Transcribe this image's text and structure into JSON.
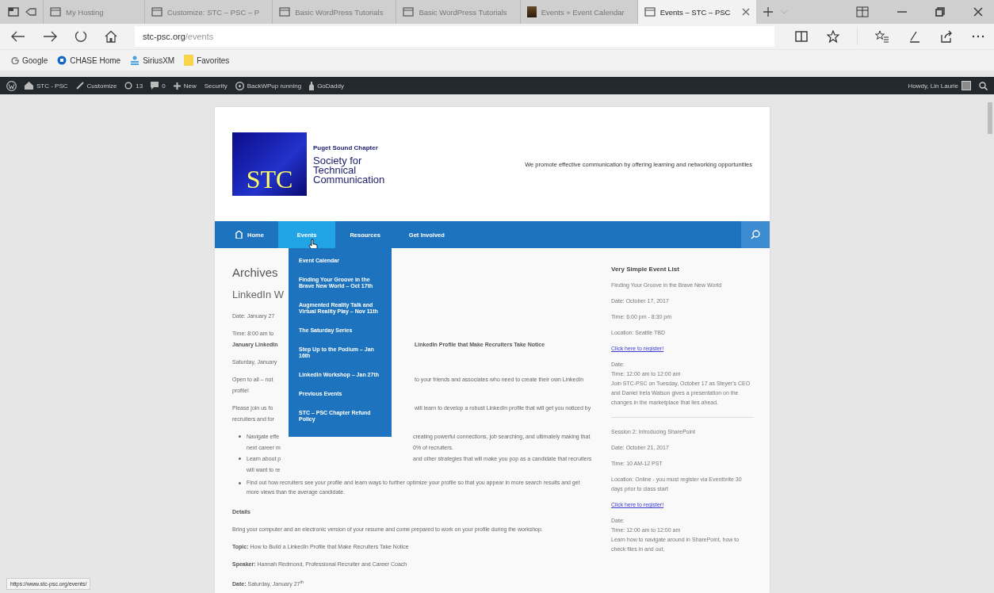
{
  "browser": {
    "tabs": [
      {
        "label": "My Hosting",
        "selected": false
      },
      {
        "label": "Customize: STC – PSC – P",
        "selected": false
      },
      {
        "label": "Basic WordPress Tutorials",
        "selected": false
      },
      {
        "label": "Basic WordPress Tutorials",
        "selected": false
      },
      {
        "label": "Events » Event Calendar",
        "selected": false
      },
      {
        "label": "Events – STC – PSC",
        "selected": true
      }
    ],
    "address": {
      "domain": "stc-psc.org",
      "path": "/events"
    },
    "favorites": [
      "Google",
      "CHASE Home",
      "SiriusXM",
      "Favorites"
    ]
  },
  "admin_bar": {
    "items": [
      "STC - PSC",
      "Customize",
      "13",
      "0",
      "New",
      "Security",
      "BackWPup running",
      "GoDaddy"
    ],
    "greeting": "Howdy, Lin Laurie"
  },
  "site": {
    "chapter": "Puget Sound Chapter",
    "logo": "STC",
    "name": [
      "Society for",
      "Technical",
      "Communication"
    ],
    "tagline": "We promote effective communication by offering learning and networking opportunities",
    "nav": [
      {
        "label": "Home",
        "selected": false
      },
      {
        "label": "Events",
        "selected": true
      },
      {
        "label": "Resources",
        "selected": false
      },
      {
        "label": "Get Involved",
        "selected": false
      }
    ],
    "dropdown": [
      "Event Calendar",
      "Finding Your Groove in the Brave New World – Oct 17th",
      "Augmented Reality Talk and Virtual Reality Play – Nov 11th",
      "The Saturday Series",
      "Step Up to the Podium – Jan 16th",
      "LinkedIn Workshop – Jan 27th",
      "Previous Events",
      "STC – PSC Chapter Refund Policy"
    ]
  },
  "main": {
    "title": "Archives",
    "post_title": "LinkedIn W",
    "lines": [
      {
        "kind": "text",
        "left": "Date: January 27"
      },
      {
        "kind": "tight",
        "left": "Time: 8:00 am  to"
      },
      {
        "kind": "bold",
        "left": "January LinkedIn",
        "right": "LinkedIn Profile that Make Recruiters Take Notice"
      },
      {
        "kind": "text",
        "left": "Saturday, January"
      },
      {
        "kind": "tight",
        "left": "Open to all – not",
        "right": "to your friends and associates who need to create their own LinkedIn"
      },
      {
        "kind": "text",
        "left": "profile!"
      },
      {
        "kind": "tight",
        "left": "Please join us fo",
        "right": "will learn to develop a robust LinkedIn profile that will get you noticed by"
      },
      {
        "kind": "text",
        "left": "recruiters and for"
      },
      {
        "kind": "bullet",
        "left": "Navigate effe",
        "right": "creating powerful connections, job searching, and ultimately making that"
      },
      {
        "kind": "cont",
        "left": "next career m",
        "right": "0% of recruiters."
      },
      {
        "kind": "bullet",
        "left": "Learn about p",
        "right": "and other strategies that will make you pop as a candidate that recruiters"
      },
      {
        "kind": "cont",
        "left": "will want to re"
      }
    ],
    "bullet": "Find out how recruiters see your profile and learn ways to further optimize your profile so that you appear in more search results and get more views than the average candidate.",
    "details_heading": "Details",
    "paragraphs": [
      "Bring your computer and an electronic version of your resume and come prepared to work on your profile during the workshop.",
      "**Topic:** How to Build a LinkedIn Profile that Make Recruiters Take Notice",
      "**Speaker:** Hannah Redmond, Professional Recruiter and Career Coach",
      "**Date:** Saturday, January 27$^{th}$"
    ]
  },
  "sidebar": {
    "title": "Very Simple Event List",
    "events": [
      {
        "lines": [
          "Finding Your Groove in the Brave New World",
          "Date: October 17, 2017",
          "Time: 6:00 pm - 8:30 pm",
          "Location: Seattle TBD"
        ],
        "link": "Click here to register!",
        "body": [
          "Date:",
          "Time: 12:00 am  to  12:00 am",
          "Join STC-PSC on Tuesday, October 17 as Steyer's CEO and Daniel Irela Watson gives a presentation on the changes in the marketplace that lies ahead."
        ]
      },
      {
        "lines": [
          "Session 2: Introducing SharePoint",
          "Date: October 21, 2017",
          "Time: 10 AM-12 PST",
          "Location: Online - you must register via Eventbrite 30 days prior to class start"
        ],
        "link": "Click here to register!",
        "body": [
          "Date:",
          "Time: 12:00 am  to  12:00 am",
          "Learn how to navigate around in SharePoint, how to check files in and out,"
        ]
      }
    ]
  },
  "status_url": "https://www.stc-psc.org/events/"
}
